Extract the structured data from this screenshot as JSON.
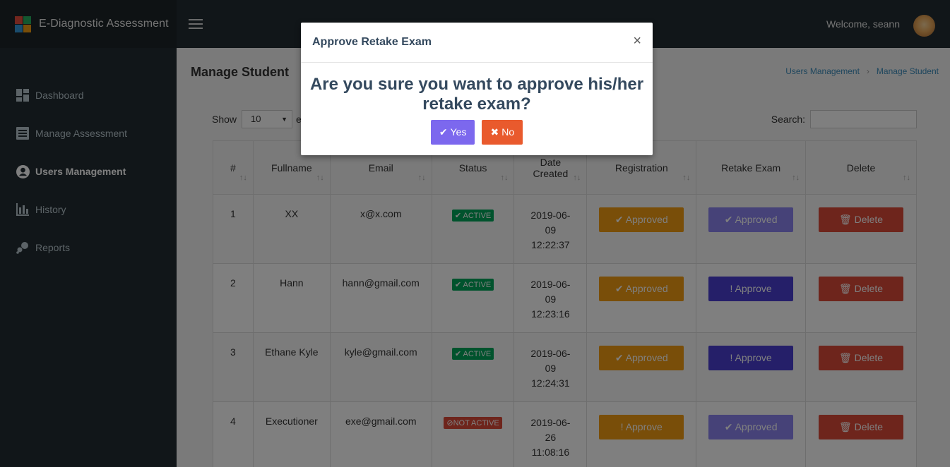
{
  "app": {
    "title": "E-Diagnostic Assessment"
  },
  "sidebar": {
    "items": [
      {
        "label": "Dashboard",
        "icon": "dashboard-icon"
      },
      {
        "label": "Manage Assessment",
        "icon": "list-icon"
      },
      {
        "label": "Users Management",
        "icon": "user-circle-icon",
        "active": true
      },
      {
        "label": "History",
        "icon": "bar-chart-icon"
      },
      {
        "label": "Reports",
        "icon": "reports-icon"
      }
    ]
  },
  "topbar": {
    "welcome": "Welcome, seann"
  },
  "page": {
    "title": "Manage Student",
    "breadcrumb": [
      "Users Management",
      "Manage Student"
    ],
    "show_label": "Show",
    "entries_value": "10",
    "entries_label": "e",
    "search_label": "Search:"
  },
  "table": {
    "headers": [
      "#",
      "Fullname",
      "Email",
      "Status",
      "Date Created",
      "Registration",
      "Retake Exam",
      "Delete"
    ],
    "header_date": [
      "Date",
      "Created"
    ],
    "rows": [
      {
        "num": "1",
        "name": "XX",
        "email": "x@x.com",
        "status": "ACTIVE",
        "date": [
          "2019-06-",
          "09",
          "12:22:37"
        ],
        "registration": "Approved",
        "retake": "Approved",
        "delete": "Delete"
      },
      {
        "num": "2",
        "name": "Hann",
        "email": "hann@gmail.com",
        "status": "ACTIVE",
        "date": [
          "2019-06-",
          "09",
          "12:23:16"
        ],
        "registration": "Approved",
        "retake": "Approve",
        "delete": "Delete"
      },
      {
        "num": "3",
        "name": "Ethane Kyle",
        "email": "kyle@gmail.com",
        "status": "ACTIVE",
        "date": [
          "2019-06-",
          "09",
          "12:24:31"
        ],
        "registration": "Approved",
        "retake": "Approve",
        "delete": "Delete"
      },
      {
        "num": "4",
        "name": "Executioner",
        "email": "exe@gmail.com",
        "status": "NOT ACTIVE",
        "date": [
          "2019-06-",
          "26",
          "11:08:16"
        ],
        "registration": "Approve",
        "retake": "Approved",
        "delete": "Delete"
      }
    ]
  },
  "modal": {
    "title": "Approve Retake Exam",
    "close": "×",
    "message": "Are you sure you want to approve his/her retake exam?",
    "yes": "Yes",
    "no": "No"
  },
  "colors": {
    "sidebar": "#222d32",
    "approved_orange": "#f39c12",
    "approved_purple": "#605ca8",
    "approve_indigo": "#4a3fd3",
    "delete_red": "#dd4b39",
    "active_green": "#00a65a",
    "modal_yes": "#7c68ee",
    "modal_no": "#e95a2d"
  }
}
